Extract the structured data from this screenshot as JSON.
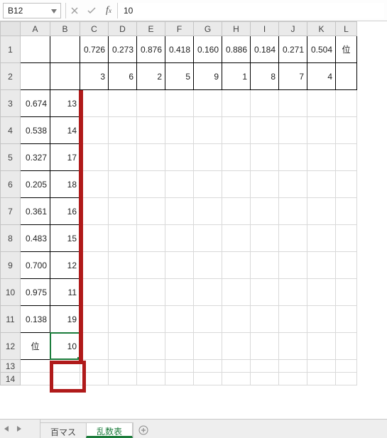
{
  "namebox": {
    "value": "B12"
  },
  "formula_bar": {
    "value": "10"
  },
  "columns": [
    "A",
    "B",
    "C",
    "D",
    "E",
    "F",
    "G",
    "H",
    "I",
    "J",
    "K",
    "L"
  ],
  "col_widths": {
    "rowhdr": 28,
    "A": 42,
    "B": 42,
    "default": 40,
    "L": 30
  },
  "row_header_count": 14,
  "row_heights": {
    "1": 38,
    "2": 38,
    "3": 38,
    "4": 38,
    "5": 38,
    "6": 38,
    "7": 38,
    "8": 38,
    "9": 38,
    "10": 38,
    "11": 38,
    "12": 38,
    "13": 18,
    "14": 18
  },
  "cells": {
    "C1": "0.726",
    "D1": "0.273",
    "E1": "0.876",
    "F1": "0.418",
    "G1": "0.160",
    "H1": "0.886",
    "I1": "0.184",
    "J1": "0.271",
    "K1": "0.504",
    "L1": "位",
    "C2": "3",
    "D2": "6",
    "E2": "2",
    "F2": "5",
    "G2": "9",
    "H2": "1",
    "I2": "8",
    "J2": "7",
    "K2": "4",
    "A3": "0.674",
    "B3": "13",
    "A4": "0.538",
    "B4": "14",
    "A5": "0.327",
    "B5": "17",
    "A6": "0.205",
    "B6": "18",
    "A7": "0.361",
    "B7": "16",
    "A8": "0.483",
    "B8": "15",
    "A9": "0.700",
    "B9": "12",
    "A10": "0.975",
    "B10": "11",
    "A11": "0.138",
    "B11": "19",
    "A12": "位",
    "B12": "10"
  },
  "active_cell": "B12",
  "sheets": {
    "tabs": [
      "百マス",
      "乱数表"
    ],
    "active": "乱数表"
  },
  "chart_data": {
    "type": "table",
    "note": "Excel worksheet cell values as visible",
    "top_row_values": [
      0.726,
      0.273,
      0.876,
      0.418,
      0.16,
      0.886,
      0.184,
      0.271,
      0.504
    ],
    "top_row_ranks": [
      3,
      6,
      2,
      5,
      9,
      1,
      8,
      7,
      4
    ],
    "left_col_values": [
      0.674,
      0.538,
      0.327,
      0.205,
      0.361,
      0.483,
      0.7,
      0.975,
      0.138
    ],
    "left_col_ranks": [
      13,
      14,
      17,
      18,
      16,
      15,
      12,
      11,
      19
    ],
    "corner_label": "位",
    "corner_value": 10
  }
}
